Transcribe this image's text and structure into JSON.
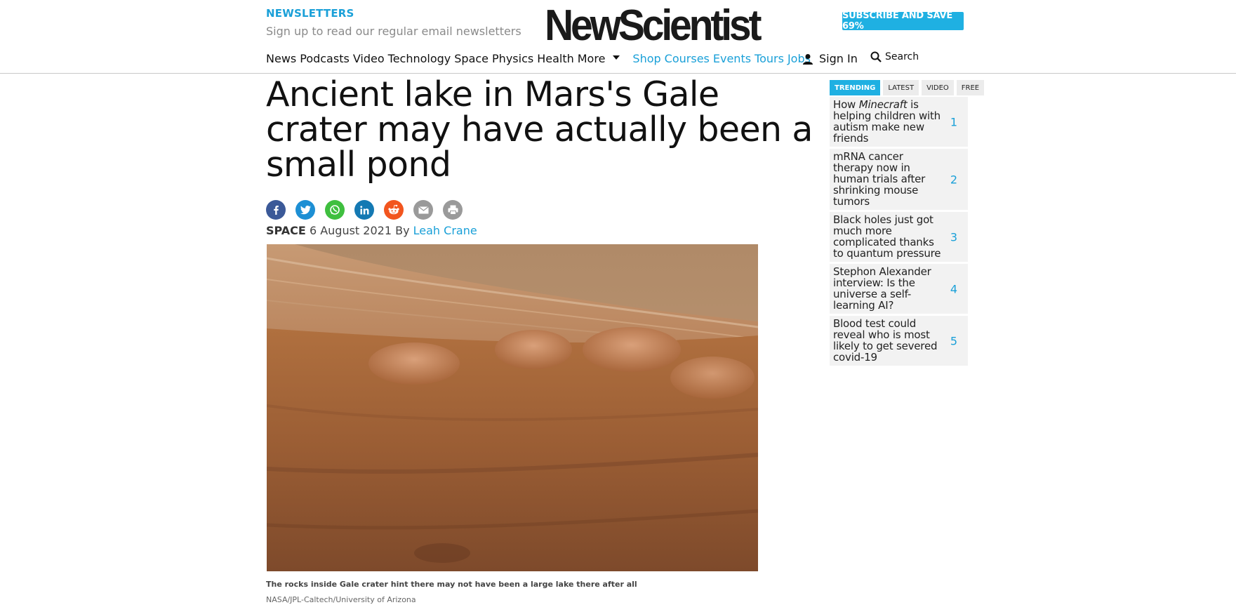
{
  "header": {
    "newsletters_title": "NEWSLETTERS",
    "newsletters_sub": "Sign up to read our regular email newsletters",
    "logo_text": "NewScientist",
    "subscribe_label": "SUBSCRIBE AND SAVE 69%",
    "nav": [
      "News",
      "Podcasts",
      "Video",
      "Technology",
      "Space",
      "Physics",
      "Health",
      "More"
    ],
    "nav_extra": [
      "Shop",
      "Courses",
      "Events",
      "Tours",
      "Jobs"
    ],
    "sign_in": "Sign In",
    "search": "Search"
  },
  "article": {
    "headline": "Ancient lake in Mars's Gale crater may have actually been a small pond",
    "section": "SPACE",
    "date": "6 August 2021",
    "by": "By",
    "author": "Leah Crane",
    "caption": "The rocks inside Gale crater hint there may not have been a large lake there after all",
    "credit": "NASA/JPL-Caltech/University of Arizona",
    "share_icons": [
      "facebook-icon",
      "twitter-icon",
      "whatsapp-icon",
      "linkedin-icon",
      "reddit-icon",
      "email-icon",
      "print-icon"
    ]
  },
  "sidebar": {
    "tabs": [
      "TRENDING",
      "LATEST",
      "VIDEO",
      "FREE"
    ],
    "trending": [
      {
        "pre": "How ",
        "em": "Minecraft",
        "post": " is helping children with autism make new friends",
        "num": "1"
      },
      {
        "pre": "mRNA cancer therapy now in human trials after shrinking mouse tumors",
        "em": "",
        "post": "",
        "num": "2"
      },
      {
        "pre": "Black holes just got much more complicated thanks to quantum pressure",
        "em": "",
        "post": "",
        "num": "3"
      },
      {
        "pre": "Stephon Alexander interview: Is the universe a self-learning AI?",
        "em": "",
        "post": "",
        "num": "4"
      },
      {
        "pre": "Blood test could reveal who is most likely to get severed covid-19",
        "em": "",
        "post": "",
        "num": "5"
      }
    ]
  },
  "colors": {
    "accent": "#1aa0d8",
    "subscribe_bg": "#1fb0e2"
  }
}
